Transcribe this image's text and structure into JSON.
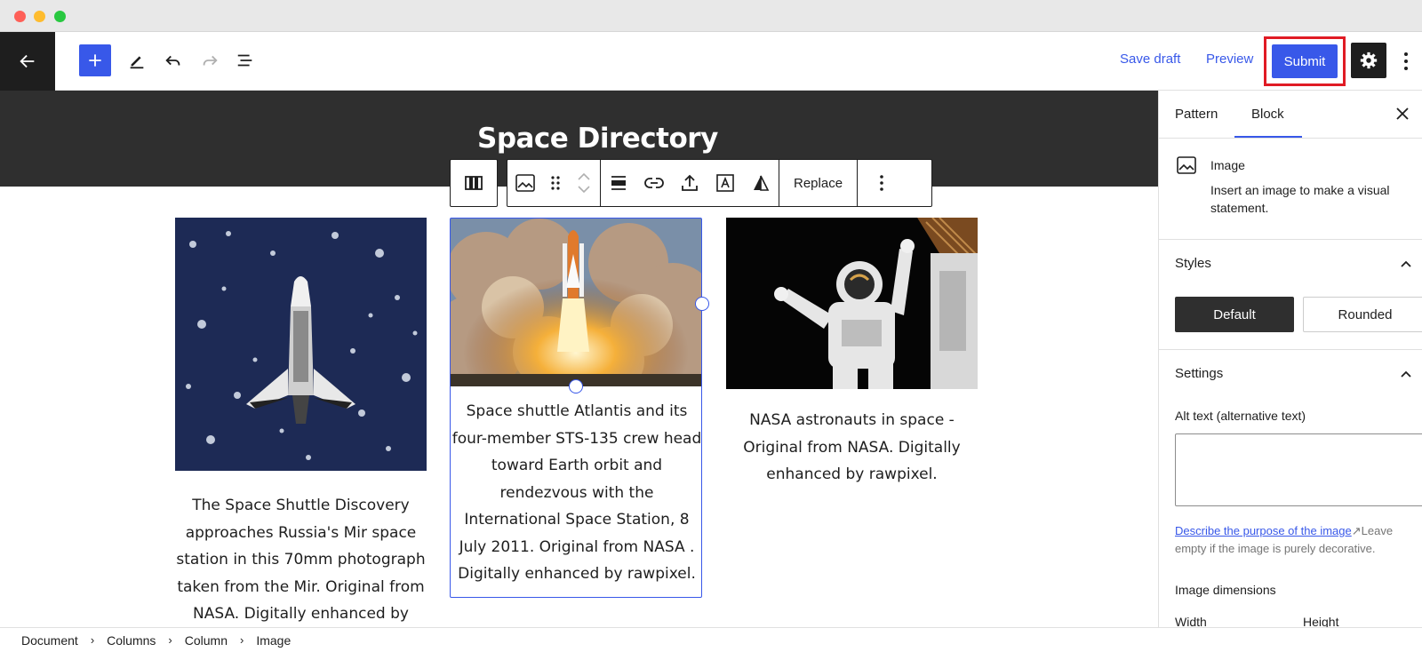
{
  "toolbar": {
    "save_draft": "Save draft",
    "preview": "Preview",
    "submit": "Submit"
  },
  "canvas": {
    "site_title": "Space Directory",
    "block_toolbar": {
      "replace": "Replace"
    },
    "columns": [
      {
        "image": "space-shuttle-discovery-approaching-mir",
        "caption": "The Space Shuttle Discovery approaches Russia's Mir space station in this 70mm photograph taken from the Mir. Original from NASA. Digitally enhanced by"
      },
      {
        "image": "space-shuttle-atlantis-launch",
        "caption": "Space shuttle Atlantis and its four-member STS-135 crew head toward Earth orbit and rendezvous with the International Space Station, 8 July 2011. Original from NASA . Digitally enhanced by rawpixel."
      },
      {
        "image": "nasa-astronaut-spacewalk",
        "caption": "NASA astronauts in space - Original from NASA. Digitally enhanced by rawpixel."
      }
    ]
  },
  "sidebar": {
    "tabs": [
      "Pattern",
      "Block"
    ],
    "active_tab": "Block",
    "block": {
      "name": "Image",
      "description": "Insert an image to make a visual statement."
    },
    "styles": {
      "heading": "Styles",
      "options": [
        "Default",
        "Rounded"
      ],
      "selected": "Default"
    },
    "settings": {
      "heading": "Settings",
      "alt_label": "Alt text (alternative text)",
      "alt_value": "",
      "help_link": "Describe the purpose of the image",
      "help_rest": "Leave empty if the image is purely decorative.",
      "dimensions": "Image dimensions",
      "width": "Width",
      "height": "Height"
    }
  },
  "breadcrumb": [
    "Document",
    "Columns",
    "Column",
    "Image"
  ],
  "colors": {
    "accent": "#3858e9",
    "dark": "#1e1e1e",
    "highlight": "#e01b24"
  }
}
